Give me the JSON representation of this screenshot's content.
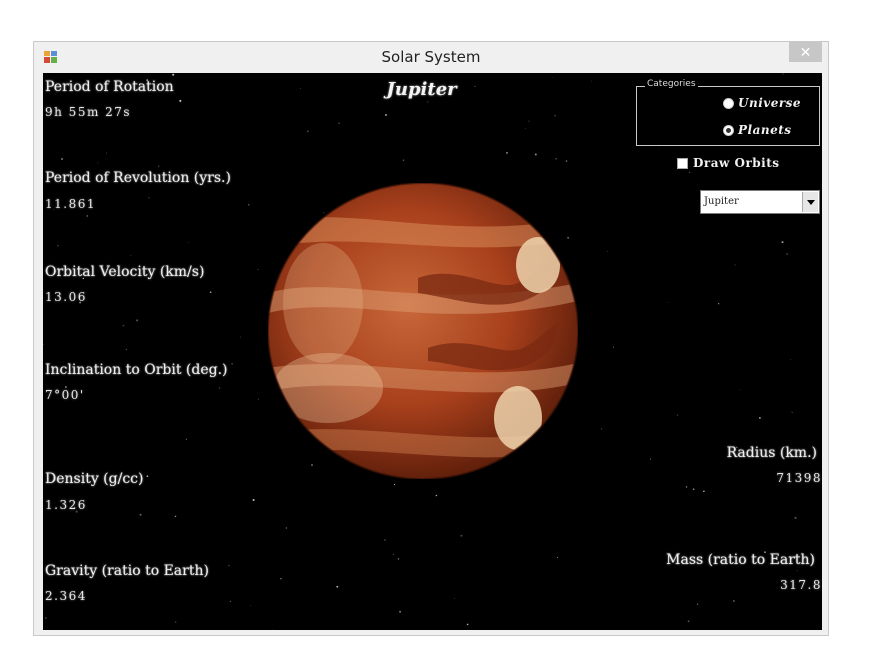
{
  "window": {
    "title": "Solar System",
    "close_symbol": "✕"
  },
  "planet": {
    "name": "Jupiter",
    "image_icon": "jupiter-planet-image"
  },
  "stats_left": [
    {
      "label": "Period of Rotation",
      "value": "9h 55m 27s"
    },
    {
      "label": "Period of Revolution (yrs.)",
      "value": "11.861"
    },
    {
      "label": "Orbital Velocity (km/s)",
      "value": "13.06"
    },
    {
      "label": "Inclination to Orbit (deg.)",
      "value": "7°00'"
    },
    {
      "label": "Density (g/cc)",
      "value": "1.326"
    },
    {
      "label": "Gravity (ratio to Earth)",
      "value": "2.364"
    }
  ],
  "stats_right": [
    {
      "label": "Radius (km.)",
      "value": "71398"
    },
    {
      "label": "Mass (ratio to Earth)",
      "value": "317.8"
    }
  ],
  "categories": {
    "legend": "Categories",
    "options": [
      {
        "label": "Universe",
        "checked": false
      },
      {
        "label": "Planets",
        "checked": true
      }
    ]
  },
  "draw_orbits": {
    "label": "Draw Orbits",
    "checked": false
  },
  "planet_select": {
    "selected": "Jupiter"
  },
  "colors": {
    "background": "#000000",
    "planet_base": "#a8401c",
    "planet_light": "#e8c7a0"
  }
}
